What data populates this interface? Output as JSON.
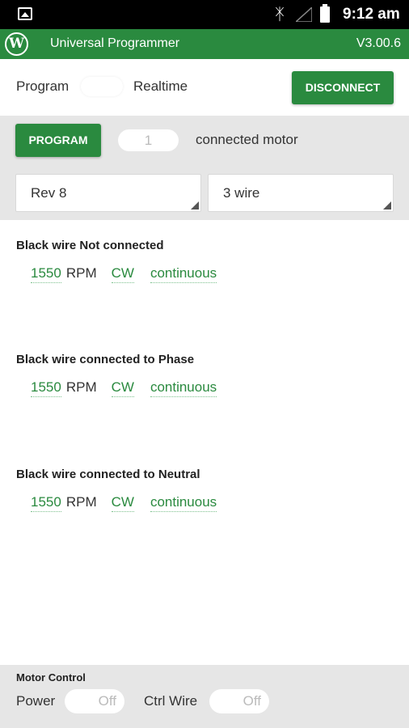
{
  "status_bar": {
    "time": "9:12 am"
  },
  "app_bar": {
    "title": "Universal Programmer",
    "version": "V3.00.6",
    "logo_letter": "W"
  },
  "mode": {
    "left_label": "Program",
    "right_label": "Realtime",
    "disconnect_label": "DISCONNECT"
  },
  "config": {
    "program_label": "PROGRAM",
    "motor_count": "1",
    "motor_count_label": "connected motor",
    "revision": "Rev 8",
    "wire_type": "3 wire"
  },
  "entries": [
    {
      "title": "Black wire Not connected",
      "rpm": "1550",
      "unit": "RPM",
      "direction": "CW",
      "mode": "continuous"
    },
    {
      "title": "Black wire connected to Phase",
      "rpm": "1550",
      "unit": "RPM",
      "direction": "CW",
      "mode": "continuous"
    },
    {
      "title": "Black wire connected to Neutral",
      "rpm": "1550",
      "unit": "RPM",
      "direction": "CW",
      "mode": "continuous"
    }
  ],
  "footer": {
    "title": "Motor Control",
    "power_label": "Power",
    "power_state": "Off",
    "ctrl_wire_label": "Ctrl Wire",
    "ctrl_wire_state": "Off"
  },
  "colors": {
    "primary": "#2a8a3f",
    "band": "#e6e6e6",
    "status_bar": "#000000"
  }
}
